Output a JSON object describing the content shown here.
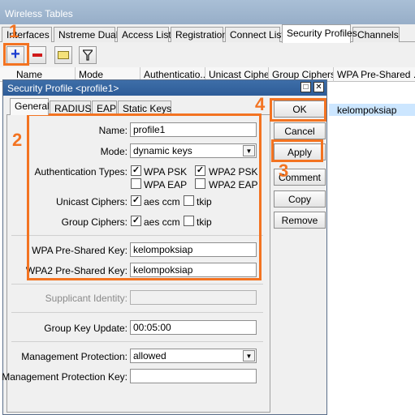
{
  "window": {
    "title": "Wireless Tables"
  },
  "tabs": [
    "Interfaces",
    "Nstreme Dual",
    "Access List",
    "Registration",
    "Connect List",
    "Security Profiles",
    "Channels"
  ],
  "list": {
    "headers": [
      "Name",
      "Mode",
      "Authenticatio...",
      "Unicast Ciphers",
      "Group Ciphers",
      "WPA Pre-Shared ..."
    ],
    "row_value": "kelompoksiap"
  },
  "dialog": {
    "title": "Security Profile <profile1>",
    "tabs": [
      "General",
      "RADIUS",
      "EAP",
      "Static Keys"
    ],
    "name_label": "Name:",
    "name_value": "profile1",
    "mode_label": "Mode:",
    "mode_value": "dynamic keys",
    "auth_label": "Authentication Types:",
    "auth": {
      "wpa_psk": "WPA PSK",
      "wpa2_psk": "WPA2 PSK",
      "wpa_eap": "WPA EAP",
      "wpa2_eap": "WPA2 EAP"
    },
    "unicast_label": "Unicast Ciphers:",
    "group_label": "Group Ciphers:",
    "cipher": {
      "aes": "aes ccm",
      "tkip": "tkip"
    },
    "wpa_key_label": "WPA Pre-Shared Key:",
    "wpa_key_value": "kelompoksiap",
    "wpa2_key_label": "WPA2 Pre-Shared Key:",
    "wpa2_key_value": "kelompoksiap",
    "supplicant_label": "Supplicant Identity:",
    "group_update_label": "Group Key Update:",
    "group_update_value": "00:05:00",
    "mgmt_prot_label": "Management Protection:",
    "mgmt_prot_value": "allowed",
    "mgmt_key_label": "Management Protection Key:",
    "buttons": {
      "ok": "OK",
      "cancel": "Cancel",
      "apply": "Apply",
      "comment": "Comment",
      "copy": "Copy",
      "remove": "Remove"
    }
  },
  "annotations": {
    "n1": "1",
    "n2": "2",
    "n3": "3",
    "n4": "4",
    "color": "#f37321"
  }
}
